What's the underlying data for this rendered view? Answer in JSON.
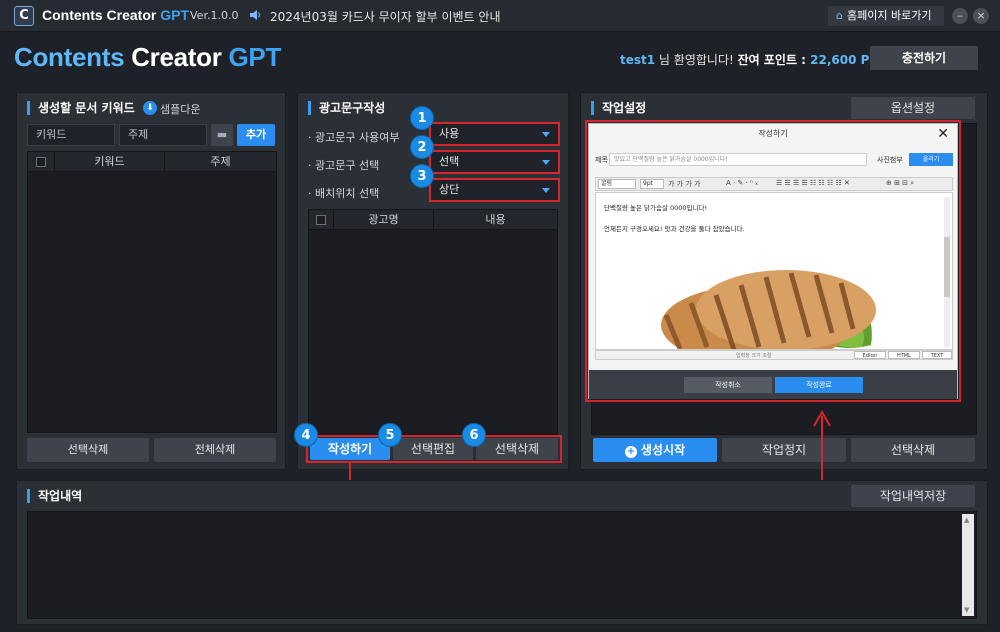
{
  "app": {
    "logo_letter": "C",
    "title_main": "Contents Creator ",
    "title_gpt": "GPT",
    "version": "Ver.1.0.0",
    "notice": "2024년03월 카드사 무이자 할부 이벤트 안내",
    "homepage": "홈페이지 바로가기",
    "minimize": "–",
    "close": "×"
  },
  "header": {
    "brand_c": "Contents",
    "brand_creator": " Creator ",
    "brand_gpt": "GPT",
    "user": "test1",
    "welcome": " 님 환영합니다! ",
    "points_label": "잔여 포인트 : ",
    "points_value": "22,600 P",
    "charge": "충전하기"
  },
  "keyword_panel": {
    "title": "생성할 문서 키워드",
    "sample_download": "샘플다운",
    "keyword_placeholder": "키워드",
    "subject_placeholder": "주제",
    "add": "추가",
    "col_keyword": "키워드",
    "col_subject": "주제",
    "delete_selected": "선택삭제",
    "delete_all": "전체삭제"
  },
  "ad_panel": {
    "title": "광고문구작성",
    "opt1_label": "· 광고문구 사용여부",
    "opt1_value": "사용",
    "opt2_label": "· 광고문구 선택",
    "opt2_value": "선택",
    "opt3_label": "· 배치위치 선택",
    "opt3_value": "상단",
    "col_name": "광고명",
    "col_content": "내용",
    "btn_write": "작성하기",
    "btn_edit": "선택편집",
    "btn_delete": "선택삭제",
    "badges": [
      "1",
      "2",
      "3",
      "4",
      "5",
      "6"
    ]
  },
  "work_panel": {
    "title": "작업설정",
    "options": "옵션설정",
    "start": "생성시작",
    "stop": "작업정지",
    "delete_selected": "선택삭제"
  },
  "editor": {
    "title": "작성하기",
    "subject_label": "제목",
    "subject_value": "맛있고 단백질량 높은 닭가슴살 0000입니다!",
    "photo_label": "사진첨부",
    "upload": "올리기",
    "font_drop": "굴림",
    "size_drop": "9pt",
    "line1": "단백질량 높은 닭가슴살 0000입니다!",
    "line2": "언제든지 구경오세요! 맛과 건강을 둘다 잡았습니다.",
    "resize_hint": "입력창 크기 조절",
    "tab_editor": "Editor",
    "tab_html": "HTML",
    "tab_text": "TEXT",
    "cancel": "작성취소",
    "done": "작성완료"
  },
  "log_panel": {
    "title": "작업내역",
    "save": "작업내역저장"
  },
  "colors": {
    "accent": "#2a8df0",
    "highlight_red": "#d7262b",
    "brand_blue": "#3ba3f0"
  }
}
